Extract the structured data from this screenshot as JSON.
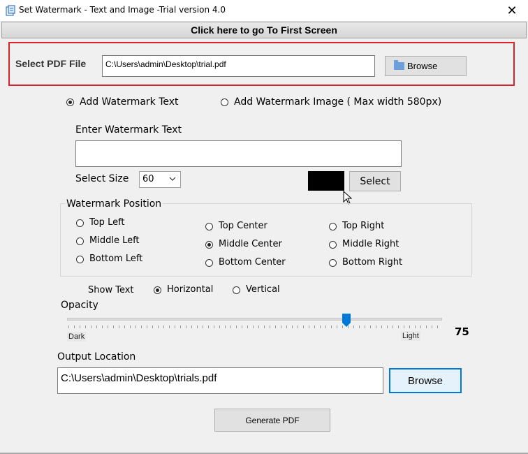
{
  "window": {
    "title": "Set Watermark  - Text and Image -Trial version 4.0",
    "close_glyph": "✕"
  },
  "first_screen": {
    "label": "Click here to go To First Screen"
  },
  "pdf_file": {
    "label": "Select PDF File",
    "path": "C:\\Users\\admin\\Desktop\\trial.pdf",
    "browse_label": "Browse"
  },
  "mode": {
    "text_label": "Add Watermark Text",
    "image_label": "Add Watermark Image ( Max width 580px)",
    "selected": "text"
  },
  "watermark_text": {
    "label": "Enter Watermark Text",
    "value": ""
  },
  "size": {
    "label": "Select Size",
    "value": "60"
  },
  "color": {
    "value": "#000000",
    "select_label": "Select"
  },
  "position": {
    "title": "Watermark Position",
    "options": [
      "Top Left",
      "Middle Left",
      "Bottom Left",
      "Top Center",
      "Middle Center",
      "Bottom Center",
      "Top Right",
      "Middle Right",
      "Bottom Right"
    ],
    "selected": "Middle Center"
  },
  "orientation": {
    "label": "Show Text",
    "horizontal": "Horizontal",
    "vertical": "Vertical",
    "selected": "horizontal"
  },
  "opacity": {
    "label": "Opacity",
    "min_label": "Dark",
    "max_label": "Light",
    "value": "75"
  },
  "output": {
    "label": "Output Location",
    "path": "C:\\Users\\admin\\Desktop\\trials.pdf",
    "browse_label": "Browse"
  },
  "generate": {
    "label": "Generate PDF"
  }
}
